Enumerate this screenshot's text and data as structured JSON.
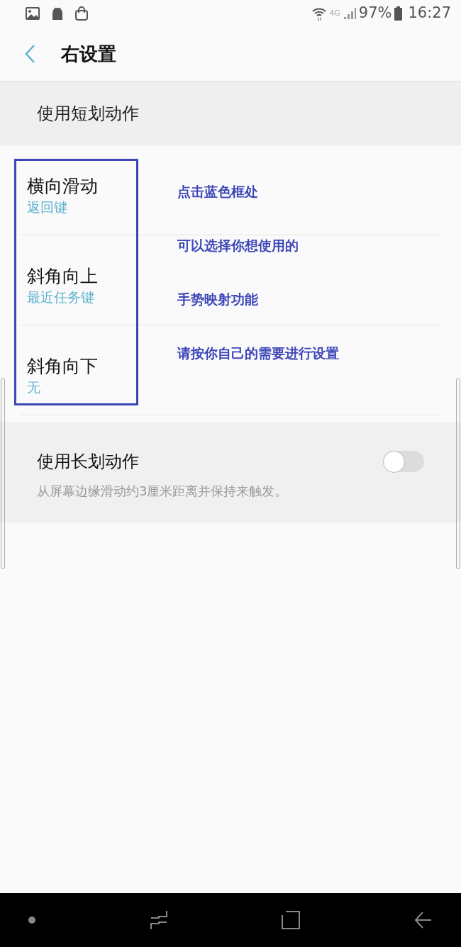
{
  "status_bar": {
    "network_type": "4G",
    "battery": "97%",
    "time": "16:27"
  },
  "header": {
    "title": "右设置"
  },
  "short_swipe": {
    "title": "使用短划动作",
    "items": [
      {
        "title": "横向滑动",
        "value": "返回键"
      },
      {
        "title": "斜角向上",
        "value": "最近任务键"
      },
      {
        "title": "斜角向下",
        "value": "无"
      }
    ],
    "annotation": {
      "notes": [
        "点击蓝色框处",
        "可以选择你想使用的",
        "手势映射功能",
        "请按你自己的需要进行设置"
      ]
    }
  },
  "long_swipe": {
    "title": "使用长划动作",
    "description": "从屏幕边缘滑动约3厘米距离并保持来触发。",
    "on": false
  }
}
